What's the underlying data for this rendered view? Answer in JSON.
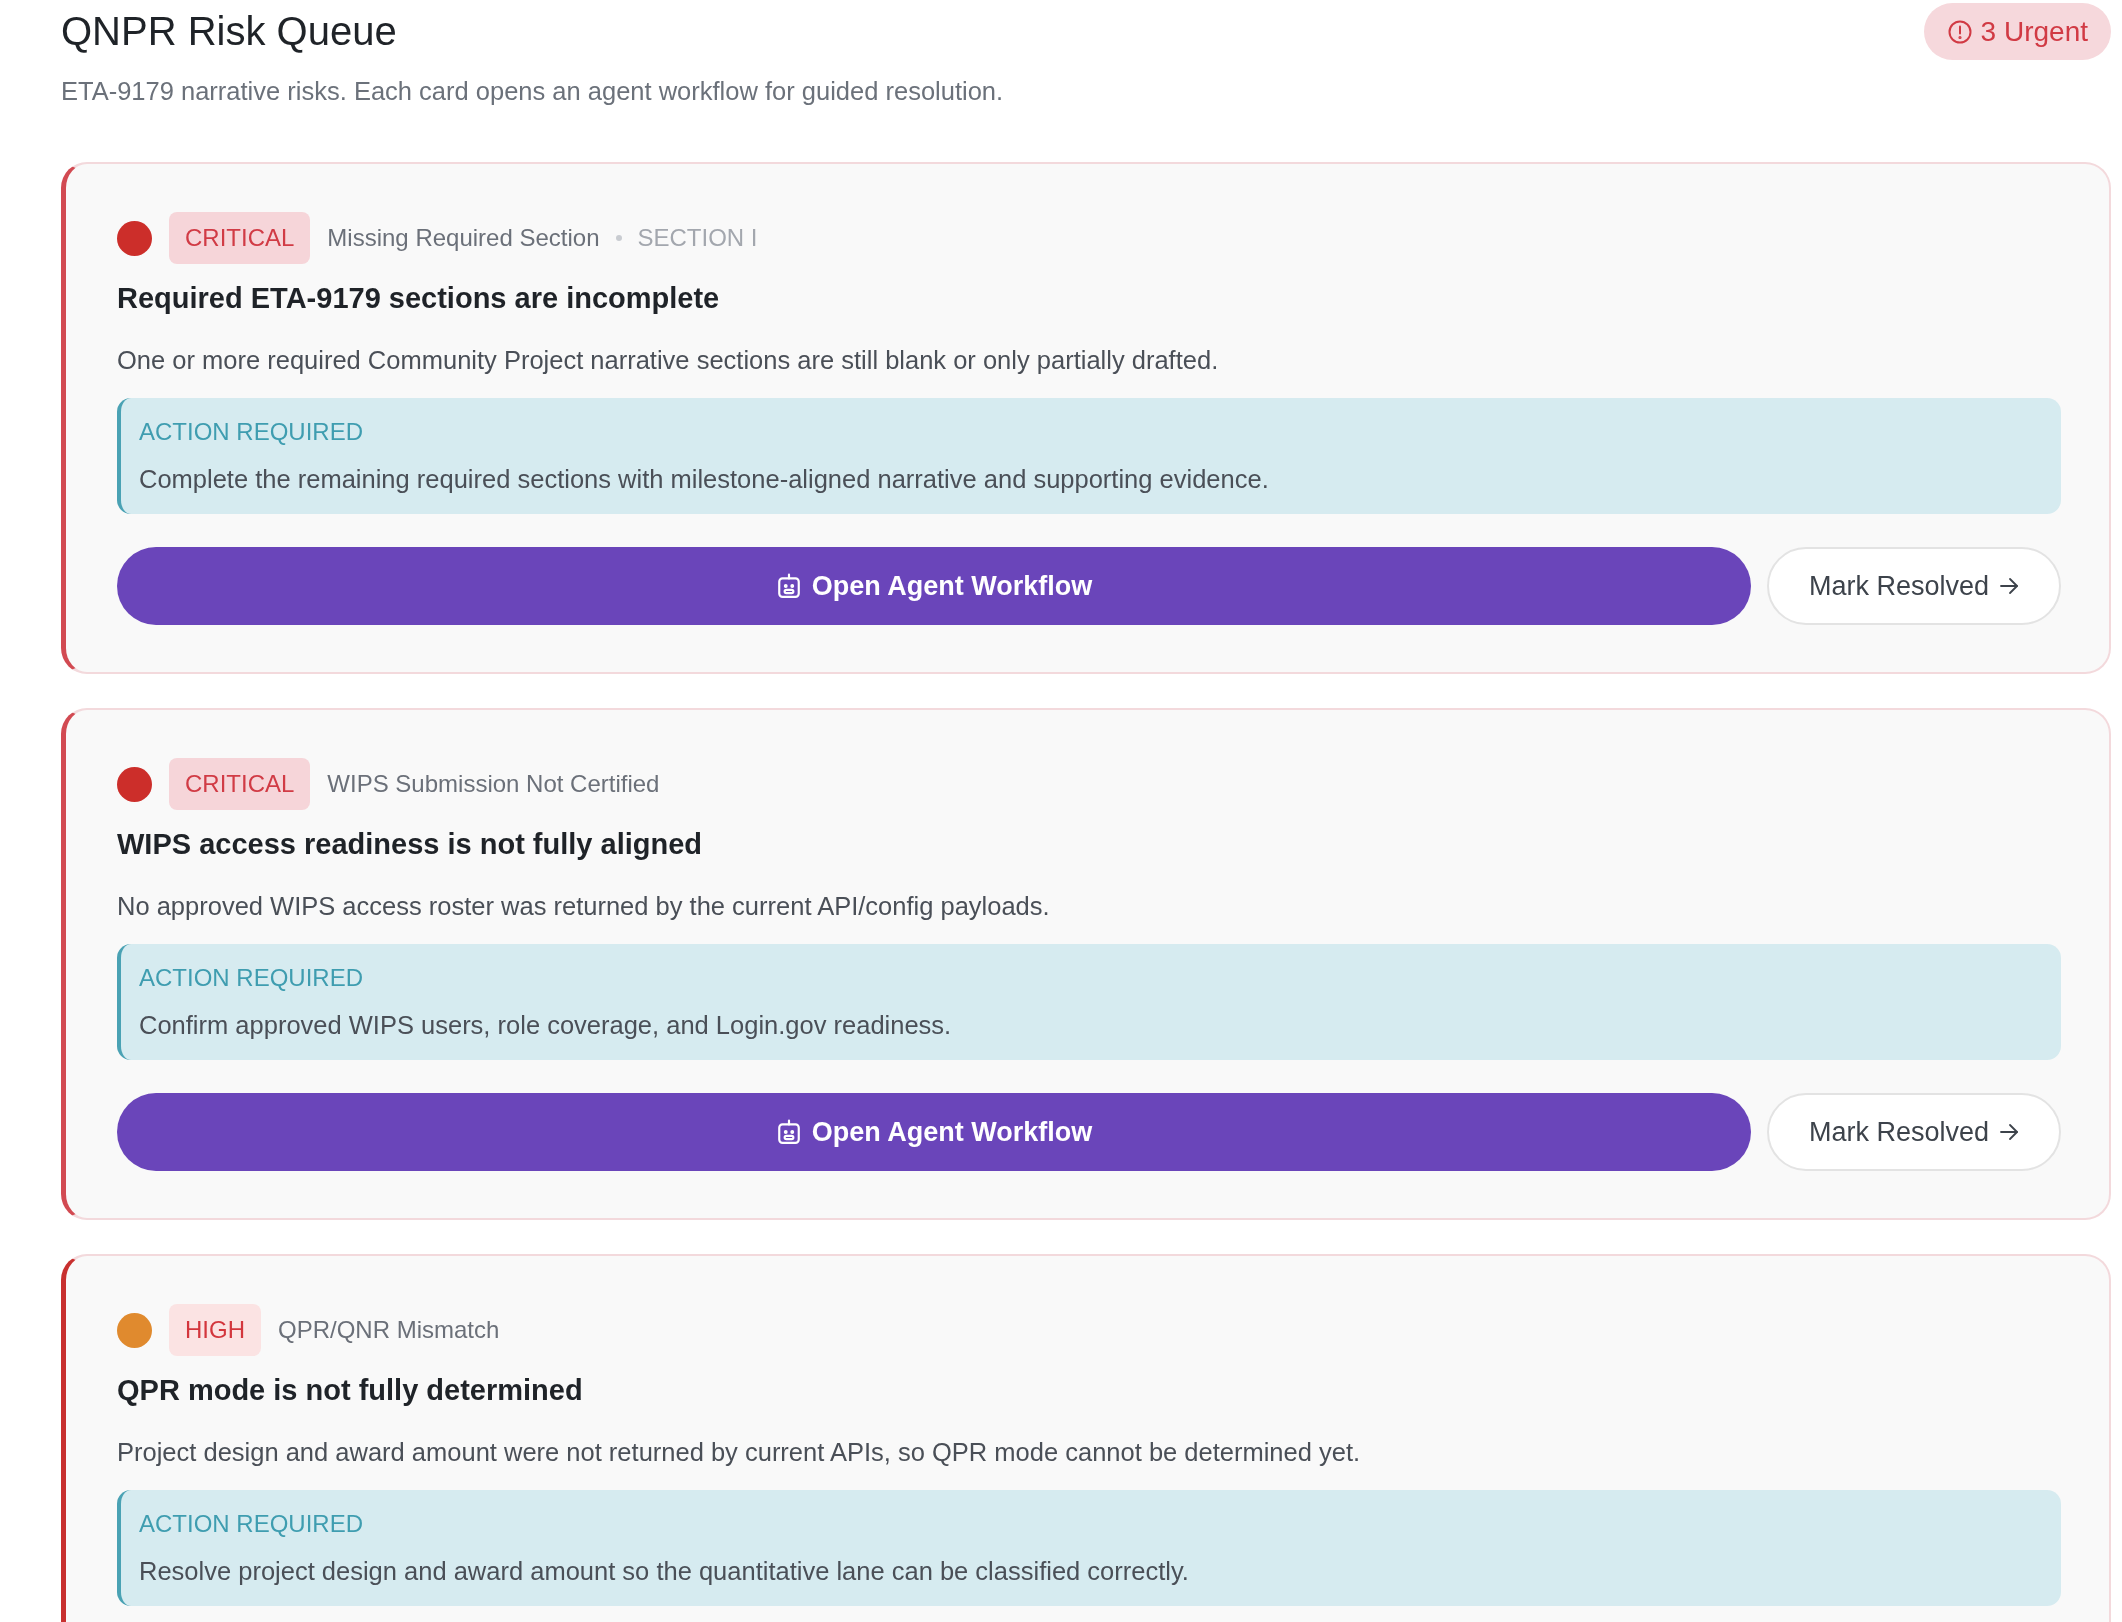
{
  "header": {
    "title": "QNPR Risk Queue",
    "subtitle": "ETA-9179 narrative risks. Each card opens an agent workflow for guided resolution.",
    "urgent_badge": "3 Urgent"
  },
  "cards": [
    {
      "kind": "critical",
      "color": "#cc2e2a",
      "severity": "CRITICAL",
      "category": "Missing Required Section",
      "section": "SECTION I",
      "title": "Required ETA-9179 sections are incomplete",
      "description": "One or more required Community Project narrative sections are still blank or only partially drafted.",
      "action": {
        "label": "ACTION REQUIRED",
        "text": "Complete the remaining required sections with milestone-aligned narrative and supporting evidence."
      },
      "buttons": {
        "primary": "Open Agent Workflow",
        "secondary": "Mark Resolved"
      }
    },
    {
      "kind": "critical",
      "color": "#cc2e2a",
      "severity": "CRITICAL",
      "category": "WIPS Submission Not Certified",
      "title": "WIPS access readiness is not fully aligned",
      "description": "No approved WIPS access roster was returned by the current API/config payloads.",
      "action": {
        "label": "ACTION REQUIRED",
        "text": "Confirm approved WIPS users, role coverage, and Login.gov readiness."
      },
      "buttons": {
        "primary": "Open Agent Workflow",
        "secondary": "Mark Resolved"
      }
    },
    {
      "kind": "high",
      "color": "#e08a2e",
      "severity": "HIGH",
      "category": "QPR/QNR Mismatch",
      "title": "QPR mode is not fully determined",
      "description": "Project design and award amount were not returned by current APIs, so QPR mode cannot be determined yet.",
      "action": {
        "label": "ACTION REQUIRED",
        "text": "Resolve project design and award amount so the quantitative lane can be classified correctly."
      }
    }
  ]
}
